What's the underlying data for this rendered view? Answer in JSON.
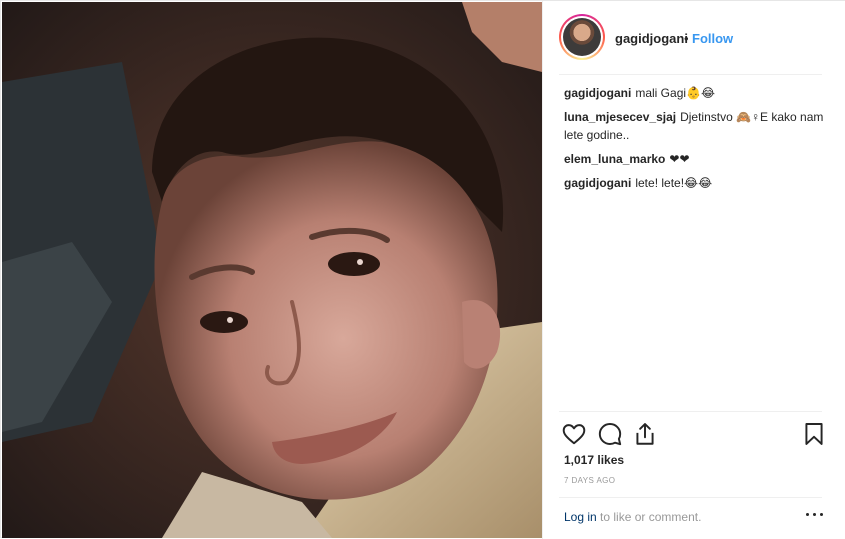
{
  "post": {
    "username": "gagidjogani",
    "separator": "•",
    "follow_label": "Follow",
    "likes": "1,017 likes",
    "time": "7 DAYS AGO",
    "footer": {
      "login_label": "Log in",
      "rest_text": " to like or comment."
    }
  },
  "comments": [
    {
      "author": "gagidjogani",
      "text": "mali Gagi👶😂"
    },
    {
      "author": "luna_mjesecev_sjaj",
      "text": "Djetinstvo 🙈♀E kako nam lete godine.."
    },
    {
      "author": "elem_luna_marko",
      "text": "❤❤"
    },
    {
      "author": "gagidjogani",
      "text": "lete! lete!😂😂"
    }
  ],
  "icons": {
    "like": "heart-icon",
    "comment": "comment-icon",
    "share": "share-icon",
    "save": "bookmark-icon",
    "more": "more-options-icon"
  },
  "colors": {
    "follow": "#3897f0",
    "muted": "#999999",
    "text": "#262626"
  }
}
